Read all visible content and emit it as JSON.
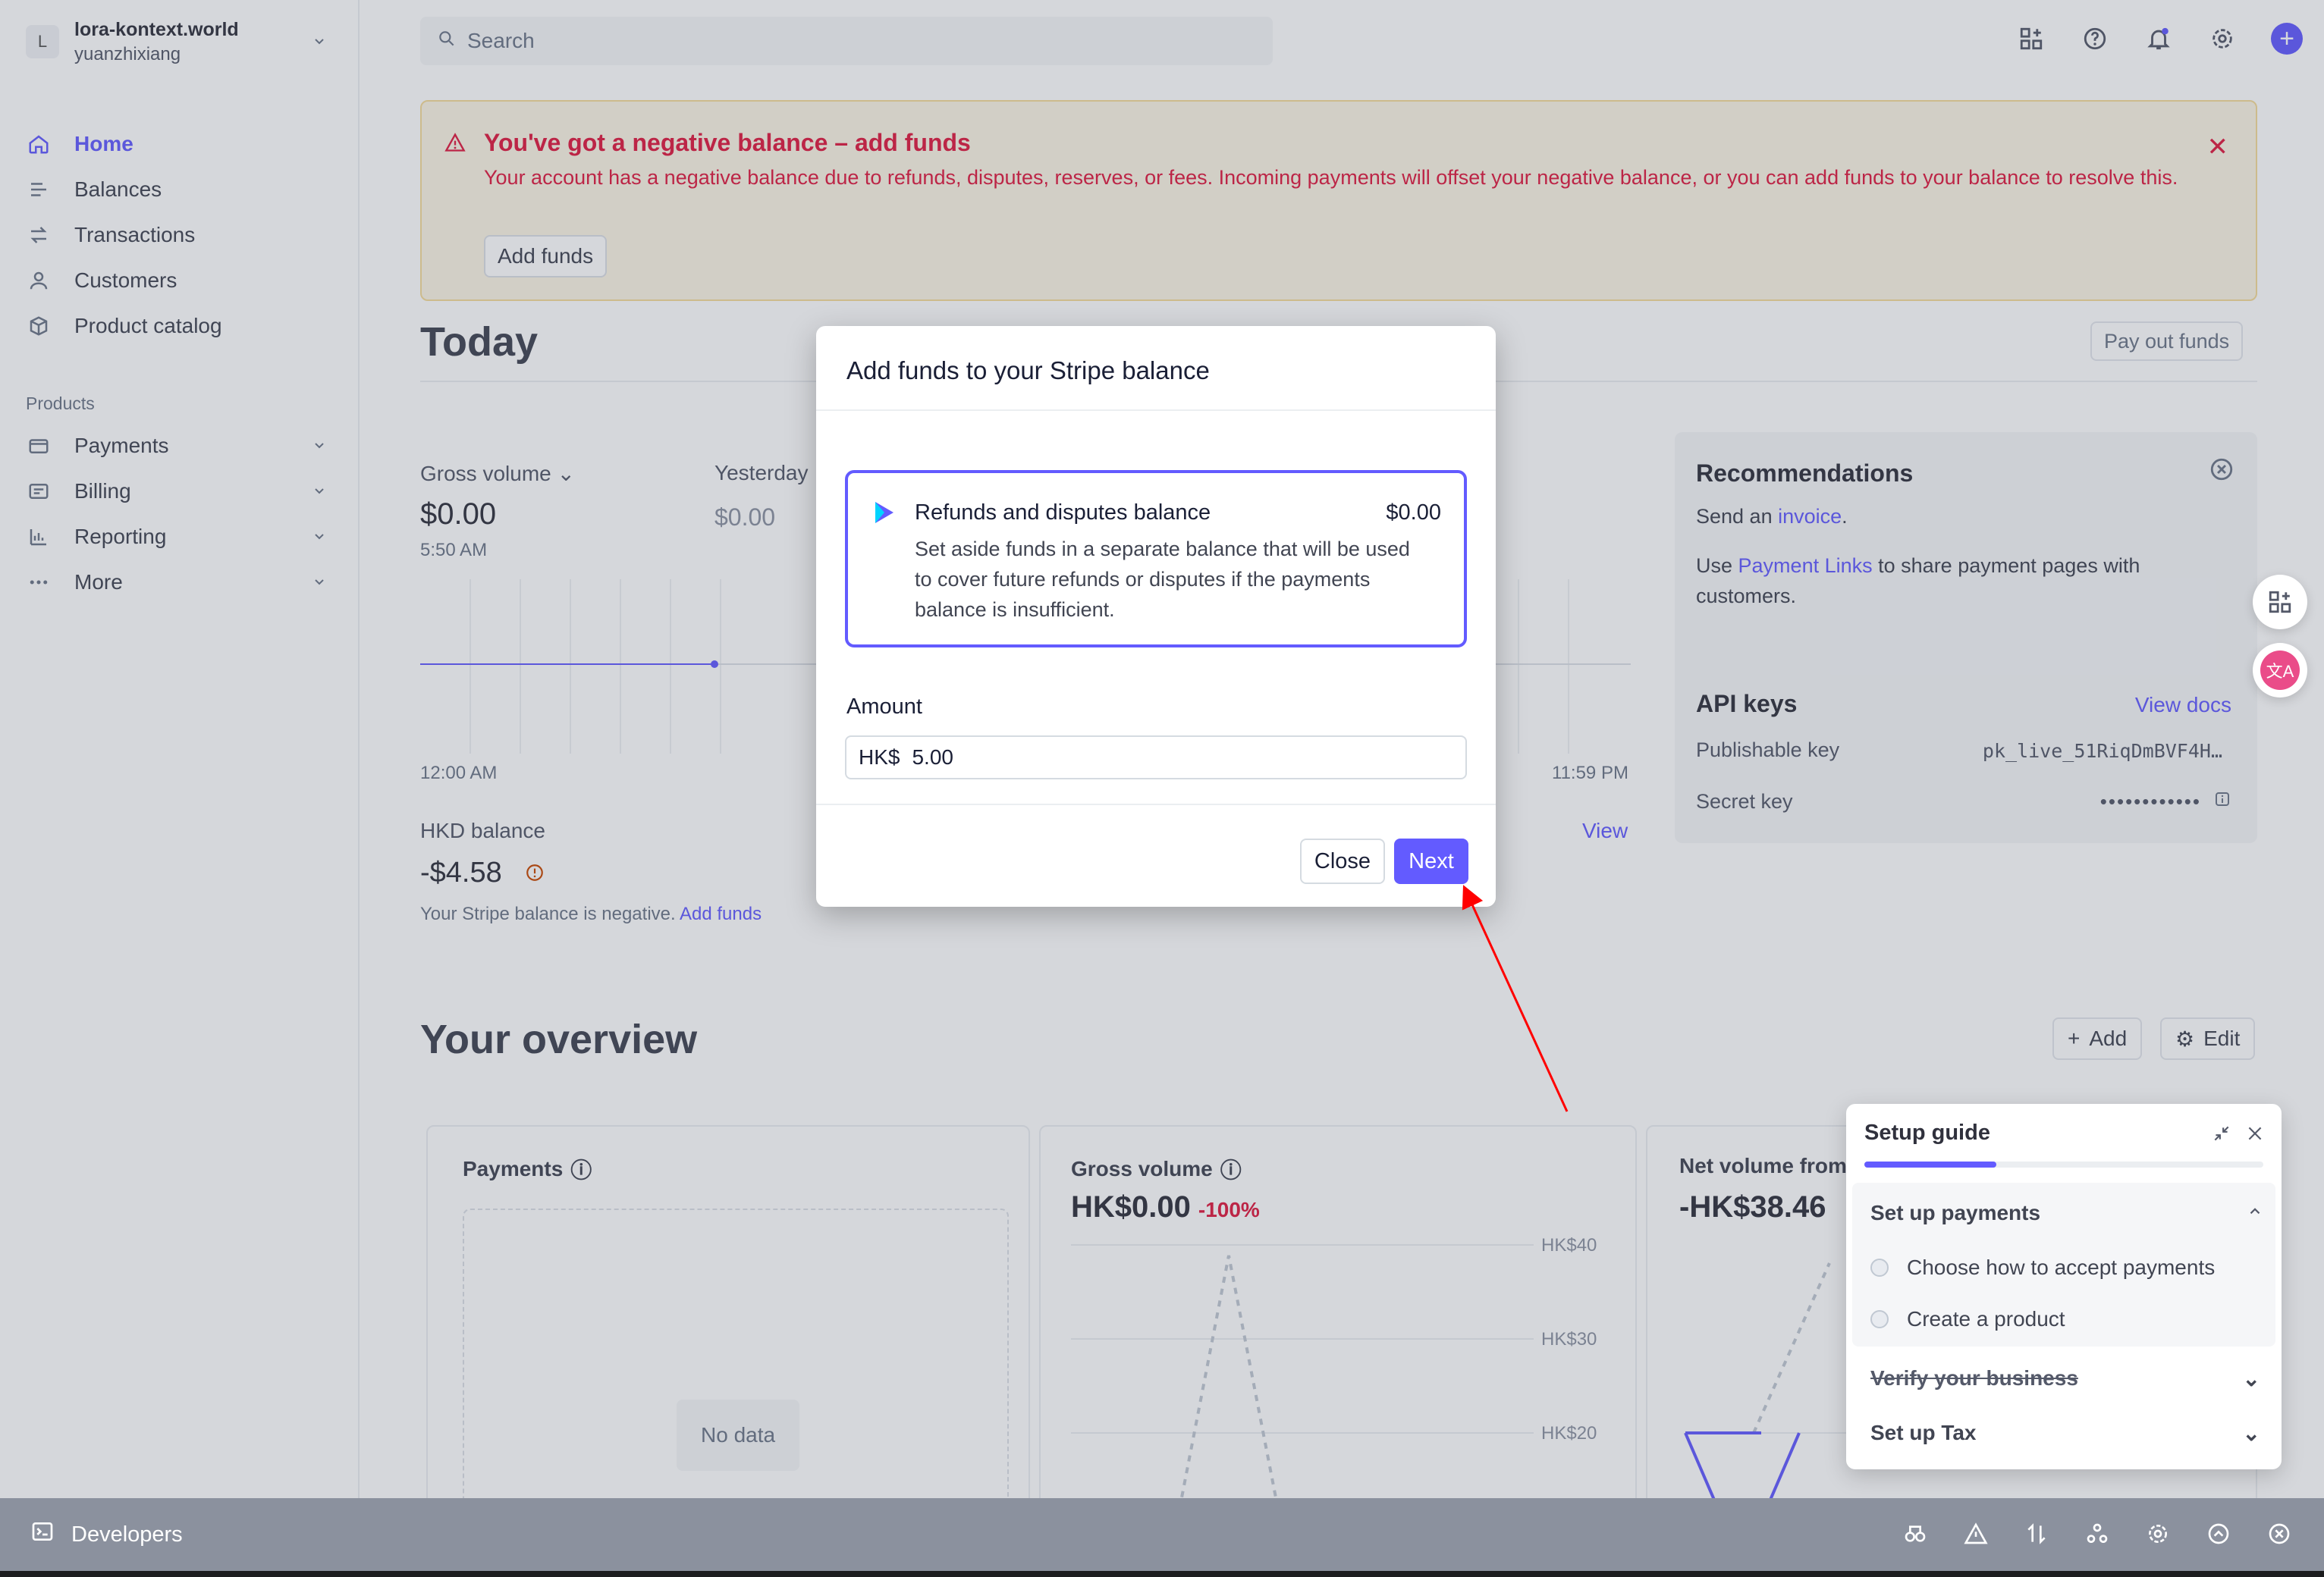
{
  "account": {
    "initial": "L",
    "name": "lora-kontext.world",
    "user": "yuanzhixiang"
  },
  "nav": {
    "items": [
      {
        "label": "Home",
        "icon": "home-icon"
      },
      {
        "label": "Balances",
        "icon": "balances-icon"
      },
      {
        "label": "Transactions",
        "icon": "transactions-icon"
      },
      {
        "label": "Customers",
        "icon": "customers-icon"
      },
      {
        "label": "Product catalog",
        "icon": "product-catalog-icon"
      }
    ],
    "products_title": "Products",
    "products": [
      {
        "label": "Payments",
        "icon": "payments-icon"
      },
      {
        "label": "Billing",
        "icon": "billing-icon"
      },
      {
        "label": "Reporting",
        "icon": "reporting-icon"
      },
      {
        "label": "More",
        "icon": "more-icon"
      }
    ]
  },
  "search": {
    "placeholder": "Search"
  },
  "banner": {
    "title": "You've got a negative balance – add funds",
    "message": "Your account has a negative balance due to refunds, disputes, reserves, or fees. Incoming payments will offset your negative balance, or you can add funds to your balance to resolve this.",
    "button": "Add funds"
  },
  "today": {
    "title": "Today",
    "payout_button": "Pay out funds",
    "gross_volume_label": "Gross volume",
    "gross_volume_value": "$0.00",
    "gross_volume_time": "5:50 AM",
    "yesterday_label": "Yesterday",
    "yesterday_value": "$0.00",
    "time_start": "12:00 AM",
    "time_end": "11:59 PM",
    "hkd_label": "HKD balance",
    "hkd_value": "-$4.58",
    "hkd_note": "Your Stripe balance is negative.",
    "hkd_note_link": "Add funds",
    "view_link": "View"
  },
  "recommendations": {
    "title": "Recommendations",
    "line1_prefix": "Send an",
    "line1_link": "invoice",
    "line1_suffix": ".",
    "line2_prefix": "Use",
    "line2_link": "Payment Links",
    "line2_suffix": "to share payment pages with customers."
  },
  "api_keys": {
    "title": "API keys",
    "docs_link": "View docs",
    "publishable_label": "Publishable key",
    "publishable_value": "pk_live_51RiqDmBVF4H…",
    "secret_label": "Secret key",
    "secret_value": "••••••••••••"
  },
  "overview": {
    "title": "Your overview",
    "add_button": "Add",
    "edit_button": "Edit",
    "cards": {
      "payments_title": "Payments",
      "no_data": "No data",
      "gross_title": "Gross volume",
      "gross_value": "HK$0.00",
      "gross_delta": "-100%",
      "gross_axis": [
        "HK$40",
        "HK$30",
        "HK$20"
      ],
      "net_title": "Net volume from",
      "net_value": "-HK$38.46"
    }
  },
  "modal": {
    "title": "Add funds to your Stripe balance",
    "option_title": "Refunds and disputes balance",
    "option_amount": "$0.00",
    "option_desc": "Set aside funds in a separate balance that will be used to cover future refunds or disputes if the payments balance is insufficient.",
    "amount_label": "Amount",
    "currency": "HK$",
    "amount_value": "5.00",
    "close_button": "Close",
    "next_button": "Next"
  },
  "setup_guide": {
    "title": "Setup guide",
    "progress": 0.33,
    "section_title": "Set up payments",
    "tasks": [
      "Choose how to accept payments",
      "Create a product"
    ],
    "verify": "Verify your business",
    "tax": "Set up Tax"
  },
  "devbar": {
    "label": "Developers"
  },
  "colors": {
    "accent": "#635bff",
    "danger": "#df1b41",
    "annotation": "#ff0000"
  }
}
